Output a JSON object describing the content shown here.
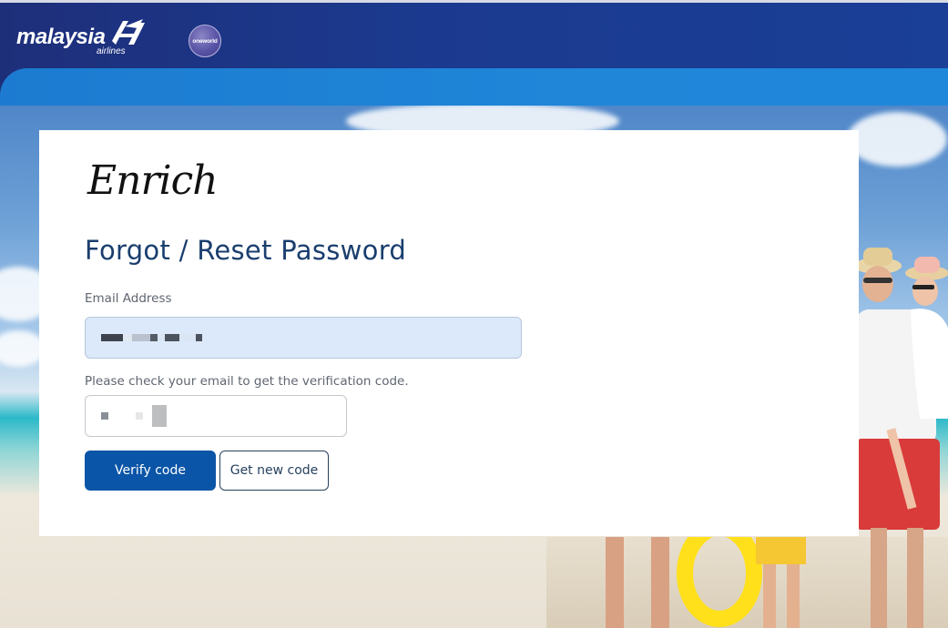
{
  "header": {
    "brand_name": "malaysia",
    "brand_sub": "airlines",
    "alliance_logo_text": "oneworld"
  },
  "card": {
    "logo_text": "Enrich",
    "title": "Forgot / Reset Password",
    "email_label": "Email Address",
    "hint_text": "Please check your email to get the verification code.",
    "verify_button": "Verify code",
    "new_code_button": "Get new code"
  },
  "colors": {
    "primary": "#0a55a8",
    "title": "#1a3e6e",
    "header_dark": "#1e2f7a",
    "header_band": "#1f86d8",
    "email_fill": "#dce9fb"
  }
}
